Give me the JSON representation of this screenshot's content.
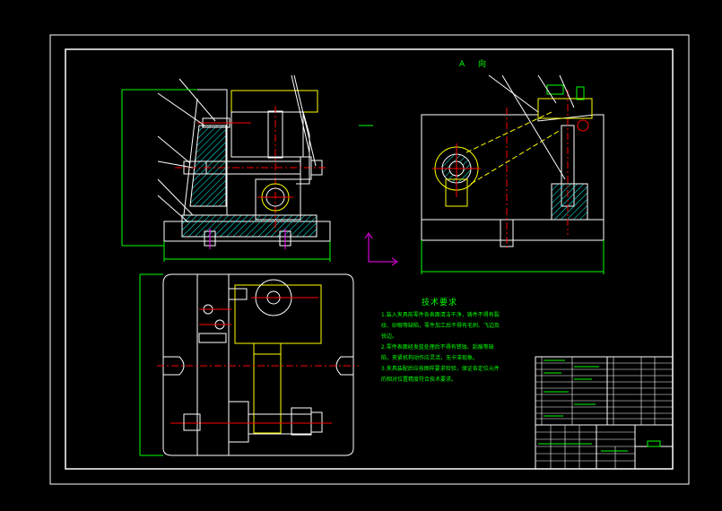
{
  "drawing": {
    "view_label": "A 向",
    "notes_title": "技术要求",
    "notes": [
      "1.装入夹具前零件各表面清洁干净，铸件不得有裂",
      "纹、砂眼等缺陷，零件加工后不得有毛刺、飞边及",
      "锐边。",
      "2.零件表面经发蓝处理后不得有锈蚀、刮痕等缺",
      "陷，夹紧机构动作应灵活，无卡滞现象。",
      "3.夹具装配后应按图样要求检验，保证各定位元件",
      "的相对位置精度符合技术要求。"
    ]
  },
  "colors": {
    "background": "#000000",
    "frame": "#ffffff",
    "outline": "#ffffff",
    "centerline": "#ff0000",
    "hatch": "#00ffff",
    "part": "#ffff00",
    "dimension": "#00ff00",
    "accent": "#ff00ff"
  }
}
